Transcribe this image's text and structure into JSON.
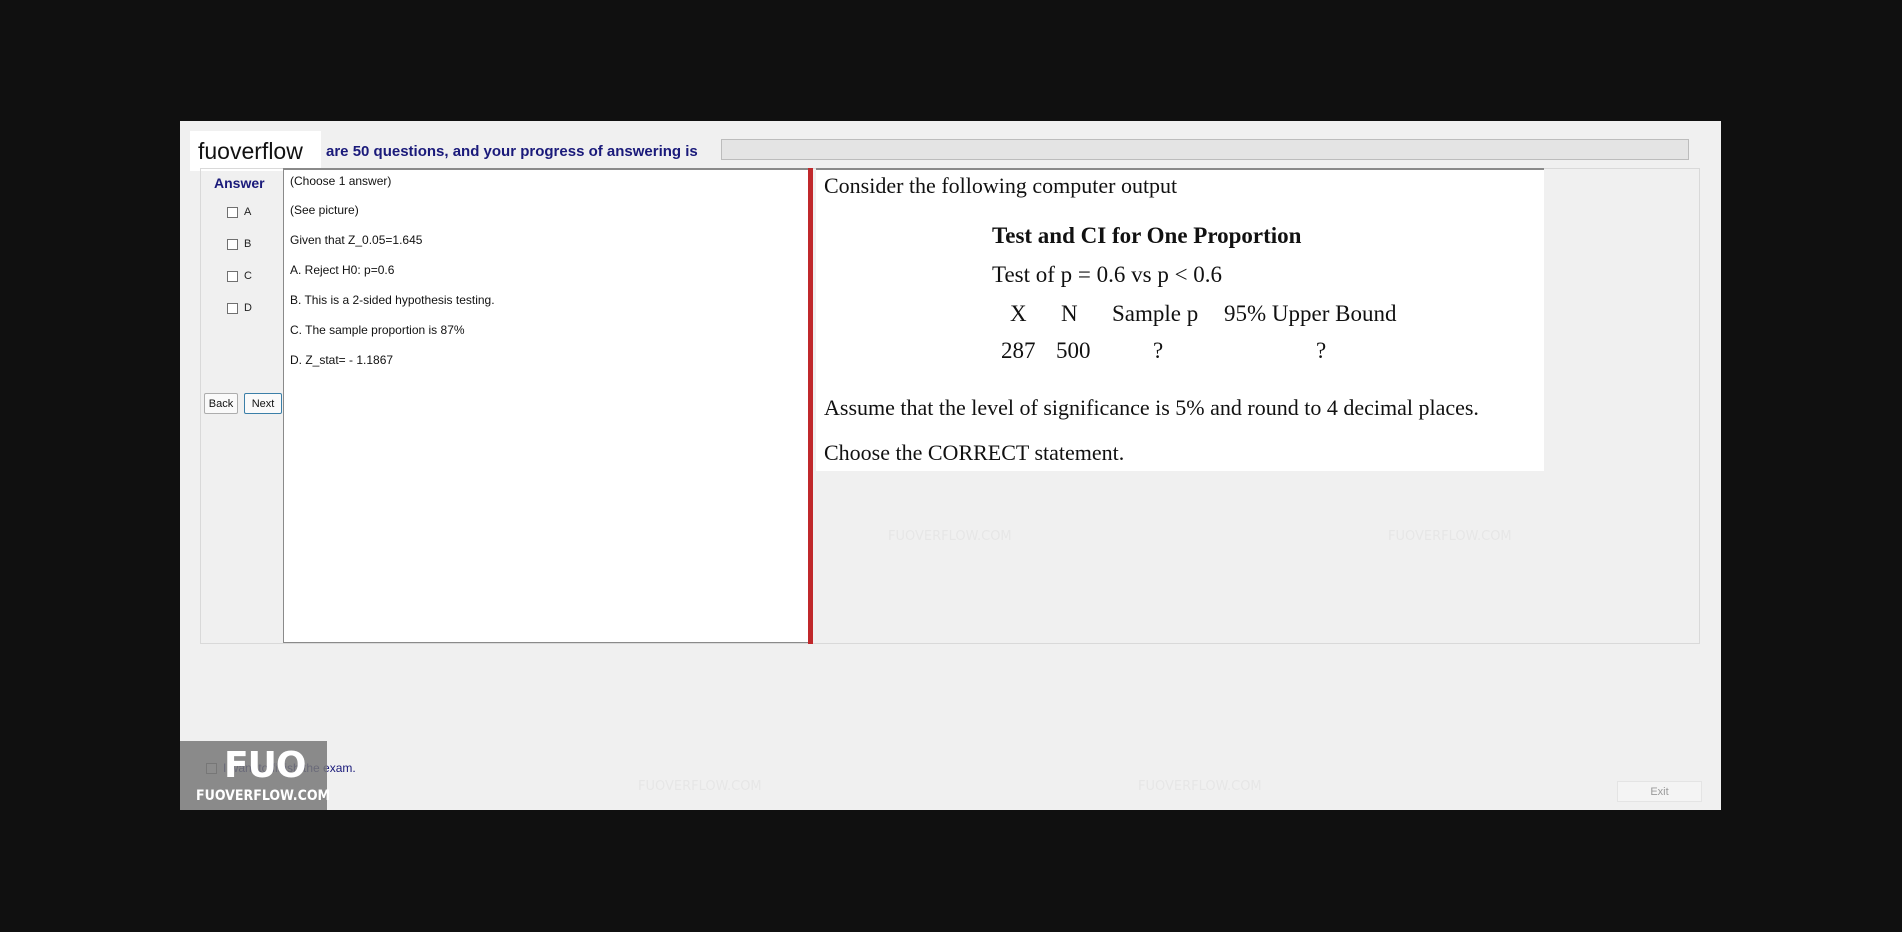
{
  "app": {
    "site_label": "fuoverflow",
    "progress_text": "are 50 questions, and your progress of answering is"
  },
  "answer_panel": {
    "heading": "Answer",
    "options": [
      "A",
      "B",
      "C",
      "D"
    ],
    "back_label": "Back",
    "next_label": "Next"
  },
  "question": {
    "lines": [
      "(Choose 1 answer)",
      "(See picture)",
      "Given that Z_0.05=1.645",
      "A.  Reject H0: p=0.6",
      "B.  This is a 2-sided hypothesis testing.",
      "C.  The sample proportion is 87%",
      "D.  Z_stat= - 1.1867"
    ]
  },
  "image": {
    "intro": "Consider the following computer output",
    "table_title": "Test and CI for One Proportion",
    "test_line": "Test of p = 0.6 vs p < 0.6",
    "headers": [
      "X",
      "N",
      "Sample p",
      "95% Upper Bound"
    ],
    "row": [
      "287",
      "500",
      "?",
      "?"
    ],
    "assumption": "Assume that the level of significance is 5% and round to 4 decimal places.",
    "instruction": "Choose the CORRECT statement."
  },
  "footer": {
    "finish_label": "I want to finish the exam.",
    "exit_label": "Exit",
    "logo_top": "FUO",
    "logo_bottom": "FUOVERFLOW.COM"
  },
  "watermark": "FUOVERFLOW.COM"
}
